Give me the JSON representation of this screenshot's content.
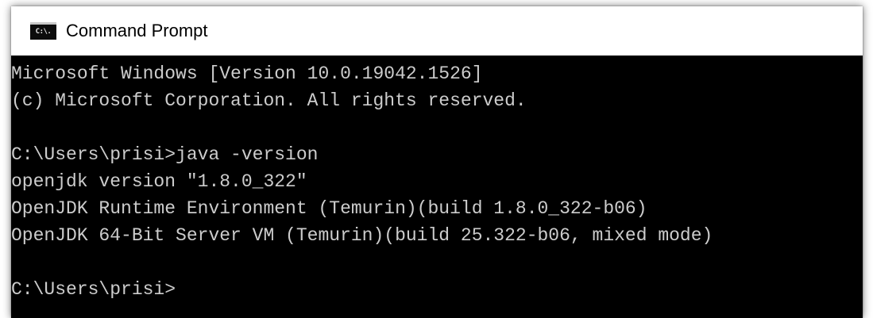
{
  "window": {
    "title": "Command Prompt",
    "icon": "cmd-icon",
    "icon_text": "C:\\."
  },
  "console": {
    "lines": [
      "Microsoft Windows [Version 10.0.19042.1526]",
      "(c) Microsoft Corporation. All rights reserved.",
      "",
      "C:\\Users\\prisi>java -version",
      "openjdk version \"1.8.0_322\"",
      "OpenJDK Runtime Environment (Temurin)(build 1.8.0_322-b06)",
      "OpenJDK 64-Bit Server VM (Temurin)(build 25.322-b06, mixed mode)",
      "",
      "C:\\Users\\prisi>"
    ],
    "text_color": "#cccccc",
    "background_color": "#000000"
  }
}
